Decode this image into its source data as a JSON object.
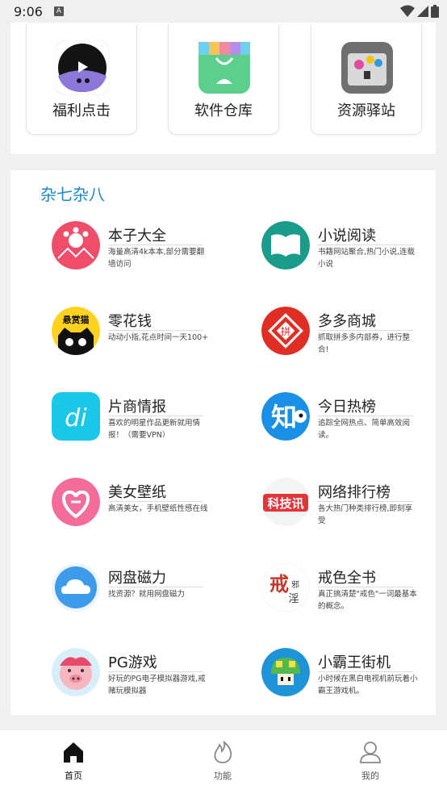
{
  "status": {
    "time": "9:06",
    "notif_icon": "A"
  },
  "top_tiles": [
    {
      "label": "福利点击",
      "icon": "play-icon"
    },
    {
      "label": "软件仓库",
      "icon": "store-bag-icon"
    },
    {
      "label": "资源驿站",
      "icon": "chest-icon"
    }
  ],
  "section": {
    "title": "杂七杂八"
  },
  "apps": [
    {
      "name": "本子大全",
      "desc": "海量高清4k本本,部分需要翻墙访问",
      "icon": "paw-icon",
      "color": "#ef4d6a"
    },
    {
      "name": "小说阅读",
      "desc": "书籍网站聚合,热门小说,连载小说",
      "icon": "book-icon",
      "color": "#1b9b8a"
    },
    {
      "name": "零花钱",
      "desc": "动动小指,花点时间一天100+",
      "icon": "cat-icon",
      "color": "#ffd21f"
    },
    {
      "name": "多多商城",
      "desc": "抓取拼多多内部券，进行整合!",
      "icon": "pinduoduo-icon",
      "color": "#e02e24"
    },
    {
      "name": "片商情报",
      "desc": "喜欢的明星作品更新就用情报！（需要VPN）",
      "icon": "di-icon",
      "color": "#19c8e6"
    },
    {
      "name": "今日热榜",
      "desc": "追踪全网热点、简单高效阅读。",
      "icon": "zhi-icon",
      "color": "#1a8fe6"
    },
    {
      "name": "美女壁纸",
      "desc": "高清美女，手机壁纸性感在线",
      "icon": "heart-icon",
      "color": "#f36c9a"
    },
    {
      "name": "网络排行榜",
      "desc": "各大热门种类排行榜,即刻享受",
      "icon": "kejixun-icon",
      "color": "#e0353a"
    },
    {
      "name": "网盘磁力",
      "desc": "找资源？就用网盘磁力",
      "icon": "cloud-icon",
      "color": "#3d9bea"
    },
    {
      "name": "戒色全书",
      "desc": "真正搞清楚\"戒色\"一词最基本的概念。",
      "icon": "jiese-icon",
      "color": "#ffffff"
    },
    {
      "name": "PG游戏",
      "desc": "好玩的PG电子模拟器游戏,戒赌玩模拟器",
      "icon": "pig-icon",
      "color": "#f6b7c1"
    },
    {
      "name": "小霸王街机",
      "desc": "小时候在黑白电视机前玩着小霸王游戏机。",
      "icon": "mushroom-icon",
      "color": "#1f93d8"
    }
  ],
  "nav": [
    {
      "label": "首页",
      "icon": "home-icon",
      "active": true
    },
    {
      "label": "功能",
      "icon": "flame-icon",
      "active": false
    },
    {
      "label": "我的",
      "icon": "user-icon",
      "active": false
    }
  ]
}
